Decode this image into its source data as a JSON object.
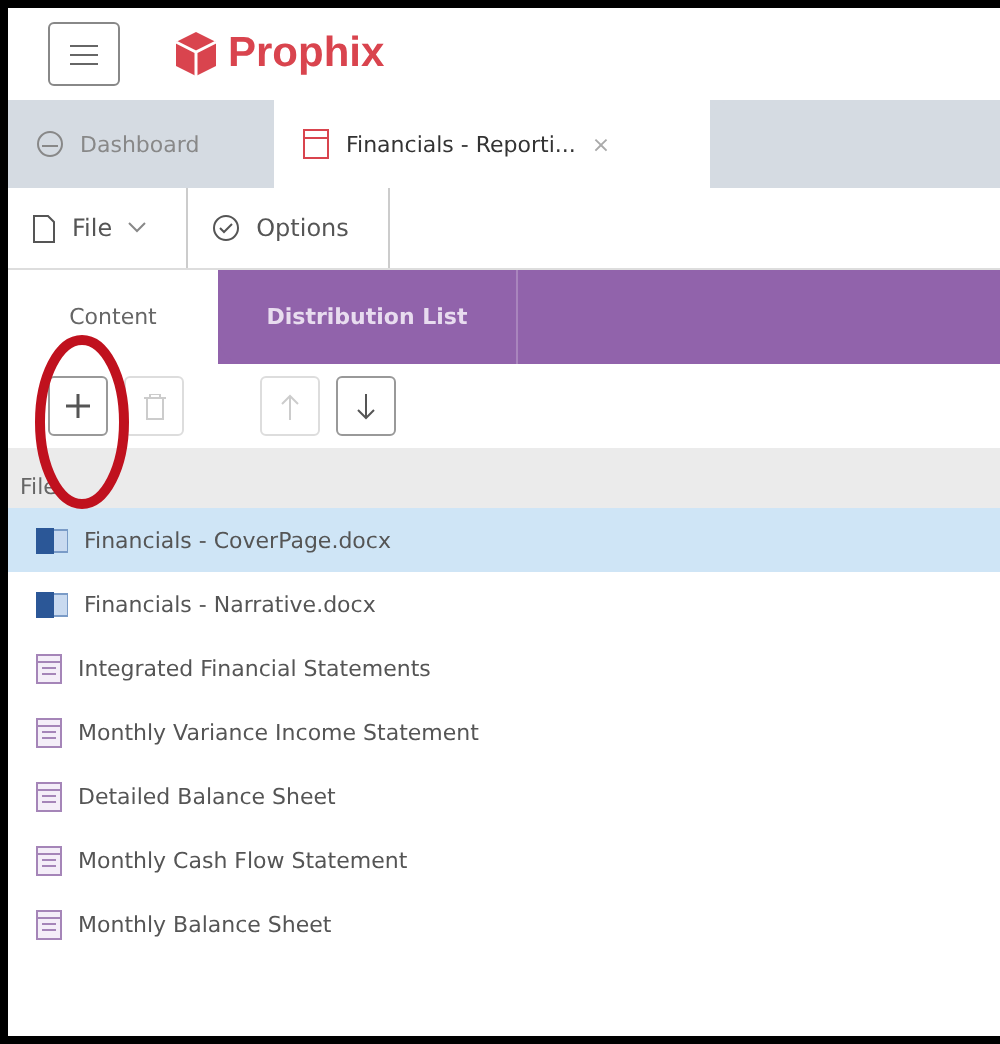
{
  "header": {
    "logo": "Prophix"
  },
  "tabs": [
    {
      "label": "Dashboard",
      "kind": "dashboard",
      "selected": false,
      "closable": false
    },
    {
      "label": "Financials - Reporti...",
      "kind": "report",
      "selected": true,
      "closable": true
    }
  ],
  "close_glyph": "×",
  "toolbar": [
    {
      "label": "File",
      "kind": "file",
      "dropdown": true
    },
    {
      "label": "Options",
      "kind": "check",
      "dropdown": false
    }
  ],
  "subtabs": [
    {
      "label": "Content",
      "selected": true
    },
    {
      "label": "Distribution List",
      "selected": false
    }
  ],
  "actions": [
    {
      "kind": "add",
      "disabled": false
    },
    {
      "kind": "delete",
      "disabled": true
    },
    {
      "kind": "up",
      "disabled": true
    },
    {
      "kind": "down",
      "disabled": false
    }
  ],
  "list": {
    "column": "File",
    "rows": [
      {
        "name": "Financials - CoverPage.docx",
        "kind": "word",
        "selected": true
      },
      {
        "name": "Financials - Narrative.docx",
        "kind": "word",
        "selected": false
      },
      {
        "name": "Integrated Financial Statements",
        "kind": "report",
        "selected": false
      },
      {
        "name": "Monthly Variance Income Statement",
        "kind": "report",
        "selected": false
      },
      {
        "name": "Detailed Balance Sheet",
        "kind": "report",
        "selected": false
      },
      {
        "name": "Monthly Cash Flow Statement",
        "kind": "report",
        "selected": false
      },
      {
        "name": "Monthly Balance Sheet",
        "kind": "report",
        "selected": false
      }
    ]
  }
}
